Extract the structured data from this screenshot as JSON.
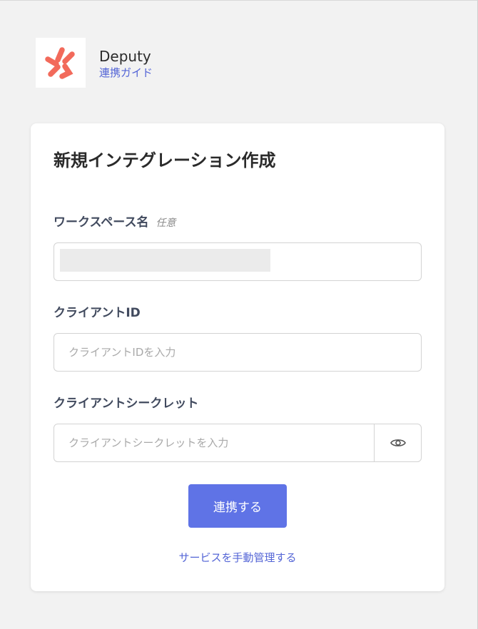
{
  "header": {
    "app_name": "Deputy",
    "guide_link": "連携ガイド"
  },
  "colors": {
    "logo_accent": "#f26a5b",
    "link": "#5465d6",
    "primary_button": "#5f73e6"
  },
  "form": {
    "title": "新規インテグレーション作成",
    "workspace": {
      "label": "ワークスペース名",
      "optional": "任意",
      "value": ""
    },
    "client_id": {
      "label": "クライアントID",
      "placeholder": "クライアントIDを入力"
    },
    "client_secret": {
      "label": "クライアントシークレット",
      "placeholder": "クライアントシークレットを入力",
      "toggle_icon": "eye-icon"
    },
    "submit_label": "連携する",
    "manual_link": "サービスを手動管理する"
  }
}
